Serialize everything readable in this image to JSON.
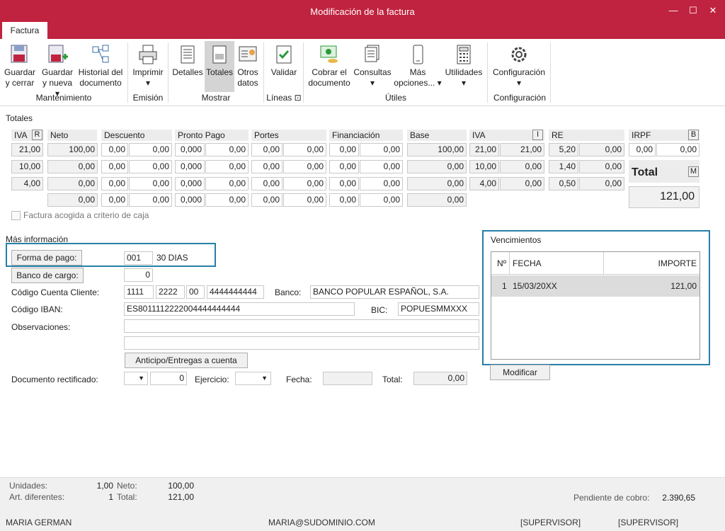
{
  "window": {
    "title": "Modificación de la factura",
    "minimize": "—",
    "maximize": "☐",
    "close": "✕"
  },
  "tab": "Factura",
  "ribbon": {
    "buttons": {
      "guardar_cerrar": "Guardar\ny cerrar",
      "guardar_nueva": "Guardar\ny nueva ▾",
      "historial": "Historial del\ndocumento",
      "imprimir": "Imprimir\n▾",
      "detalles": "Detalles",
      "totales": "Totales",
      "otros_datos": "Otros\ndatos",
      "validar": "Validar",
      "cobrar": "Cobrar el\ndocumento",
      "consultas": "Consultas\n▾",
      "mas_opciones": "Más\nopciones... ▾",
      "utilidades": "Utilidades\n▾",
      "configuracion": "Configuración\n▾"
    },
    "groups": {
      "mantenimiento": "Mantenimiento",
      "emision": "Emisión",
      "mostrar": "Mostrar",
      "lineas": "Líneas ⊡",
      "utiles": "Útiles",
      "configuracion": "Configuración"
    }
  },
  "totales": {
    "section_title": "Totales",
    "headers": {
      "iva": "IVA",
      "r": "R",
      "neto": "Neto",
      "descuento": "Descuento",
      "pronto_pago": "Pronto Pago",
      "portes": "Portes",
      "financiacion": "Financiación",
      "base": "Base",
      "iva2": "IVA",
      "i": "I",
      "re": "RE",
      "irpf": "IRPF",
      "b": "B"
    },
    "rows": [
      {
        "iva": "21,00",
        "neto": "100,00",
        "d1": "0,00",
        "d2": "0,00",
        "p1": "0,000",
        "p2": "0,00",
        "po1": "0,00",
        "po2": "0,00",
        "f1": "0,00",
        "f2": "0,00",
        "base": "100,00",
        "iv1": "21,00",
        "iv2": "21,00",
        "re1": "5,20",
        "re2": "0,00"
      },
      {
        "iva": "10,00",
        "neto": "0,00",
        "d1": "0,00",
        "d2": "0,00",
        "p1": "0,000",
        "p2": "0,00",
        "po1": "0,00",
        "po2": "0,00",
        "f1": "0,00",
        "f2": "0,00",
        "base": "0,00",
        "iv1": "10,00",
        "iv2": "0,00",
        "re1": "1,40",
        "re2": "0,00"
      },
      {
        "iva": "4,00",
        "neto": "0,00",
        "d1": "0,00",
        "d2": "0,00",
        "p1": "0,000",
        "p2": "0,00",
        "po1": "0,00",
        "po2": "0,00",
        "f1": "0,00",
        "f2": "0,00",
        "base": "0,00",
        "iv1": "4,00",
        "iv2": "0,00",
        "re1": "0,50",
        "re2": "0,00"
      },
      {
        "neto": "0,00",
        "d1": "0,00",
        "d2": "0,00",
        "p1": "0,000",
        "p2": "0,00",
        "po1": "0,00",
        "po2": "0,00",
        "f1": "0,00",
        "f2": "0,00",
        "base": "0,00"
      }
    ],
    "irpf1": "0,00",
    "irpf2": "0,00",
    "total_label": "Total",
    "m": "M",
    "total_value": "121,00",
    "criterio_caja": "Factura acogida a criterio de caja"
  },
  "mas_info": {
    "title": "Más información",
    "forma_pago_btn": "Forma de pago:",
    "forma_pago_code": "001",
    "forma_pago_desc": "30 DIAS",
    "banco_cargo_btn": "Banco de cargo:",
    "banco_cargo_value": "0",
    "cuenta_label": "Código Cuenta Cliente:",
    "c1": "1111",
    "c2": "2222",
    "c3": "00",
    "c4": "4444444444",
    "banco_label": "Banco:",
    "banco_value": "BANCO POPULAR ESPAÑOL, S.A.",
    "iban_label": "Código IBAN:",
    "iban_value": "ES8011112222004444444444",
    "bic_label": "BIC:",
    "bic_value": "POPUESMMXXX",
    "obs_label": "Observaciones:",
    "anticipo_btn": "Anticipo/Entregas a cuenta",
    "doc_rect_label": "Documento rectificado:",
    "doc_rect_num": "0",
    "ejercicio_label": "Ejercicio:",
    "fecha_label": "Fecha:",
    "total_label": "Total:",
    "total_value": "0,00"
  },
  "vencimientos": {
    "title": "Vencimientos",
    "headers": {
      "n": "Nº",
      "fecha": "FECHA",
      "importe": "IMPORTE"
    },
    "rows": [
      {
        "n": "1",
        "fecha": "15/03/20XX",
        "importe": "121,00"
      }
    ],
    "modificar_btn": "Modificar"
  },
  "footer": {
    "unidades_label": "Unidades:",
    "unidades_value": "1,00",
    "neto_label": "Neto:",
    "neto_value": "100,00",
    "art_label": "Art. diferentes:",
    "art_value": "1",
    "total_label": "Total:",
    "total_value": "121,00",
    "pendiente_label": "Pendiente de cobro:",
    "pendiente_value": "2.390,65",
    "user": "MARIA GERMAN",
    "email": "MARIA@SUDOMINIO.COM",
    "role1": "[SUPERVISOR]",
    "role2": "[SUPERVISOR]"
  }
}
